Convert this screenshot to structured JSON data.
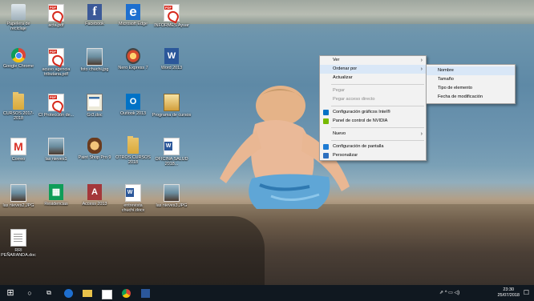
{
  "desktop_icons": [
    {
      "label": "Papelera de reciclaje",
      "icon": "recycle-bin-icon"
    },
    {
      "label": "acta.pdf",
      "icon": "pdf-icon"
    },
    {
      "label": "Facebook",
      "icon": "facebook-icon"
    },
    {
      "label": "Microsoft Edge",
      "icon": "edge-icon"
    },
    {
      "label": "INFORMES Ayuar",
      "icon": "pdf-icon"
    },
    {
      "label": "Google Chrome",
      "icon": "chrome-icon"
    },
    {
      "label": "acuso agencia tributaria.pdf",
      "icon": "pdf-icon"
    },
    {
      "label": "foto chuchi.jpg",
      "icon": "photo-icon"
    },
    {
      "label": "Nero Express 7",
      "icon": "nero-icon"
    },
    {
      "label": "Word 2013",
      "icon": "word-icon"
    },
    {
      "label": "CURSOS 2017-2018",
      "icon": "folder-icon"
    },
    {
      "label": "CI Protección de...",
      "icon": "access-doc-icon"
    },
    {
      "label": "Gr3.doc",
      "icon": "screenshot-icon"
    },
    {
      "label": "Outlook 2013",
      "icon": "outlook-icon"
    },
    {
      "label": "Programa de cursos",
      "icon": "installer-icon"
    },
    {
      "label": "Correo",
      "icon": "gmail-icon"
    },
    {
      "label": "las nieves1",
      "icon": "photo-icon"
    },
    {
      "label": "Paint Shop Pro 9",
      "icon": "paint-icon"
    },
    {
      "label": "OTROS CURSOS 2018",
      "icon": "folder-icon"
    },
    {
      "label": "OFICINA SALUD 2018...",
      "icon": "word-doc-icon"
    },
    {
      "label": "las nieves2.JPG",
      "icon": "photo-icon"
    },
    {
      "label": "Residencias",
      "icon": "sheets-icon"
    },
    {
      "label": "Access 2013",
      "icon": "access-icon"
    },
    {
      "label": "entrevista chuchi.docx",
      "icon": "word-doc-icon"
    },
    {
      "label": "las nieves3.JPG",
      "icon": "photo-icon"
    },
    {
      "label": "RRI PEÑARANDA.doc",
      "icon": "doc-icon"
    }
  ],
  "context_menu": {
    "items": [
      {
        "label": "Ver",
        "submenu": true,
        "disabled": false
      },
      {
        "label": "Ordenar por",
        "submenu": true,
        "disabled": false,
        "highlighted": true
      },
      {
        "label": "Actualizar",
        "submenu": false,
        "disabled": false
      },
      {
        "sep": true
      },
      {
        "label": "Pegar",
        "submenu": false,
        "disabled": true
      },
      {
        "label": "Pegar acceso directo",
        "submenu": false,
        "disabled": true
      },
      {
        "sep": true
      },
      {
        "label": "Configuración gráficos Intel®",
        "submenu": false,
        "disabled": false,
        "icon": "intel-icon"
      },
      {
        "label": "Panel de control de NVIDIA",
        "submenu": false,
        "disabled": false,
        "icon": "nvidia-icon"
      },
      {
        "sep": true
      },
      {
        "label": "Nuevo",
        "submenu": true,
        "disabled": false
      },
      {
        "sep": true
      },
      {
        "label": "Configuración de pantalla",
        "submenu": false,
        "disabled": false,
        "icon": "display-icon"
      },
      {
        "label": "Personalizar",
        "submenu": false,
        "disabled": false,
        "icon": "personalize-icon"
      }
    ]
  },
  "sort_submenu": {
    "items": [
      {
        "label": "Nombre",
        "highlighted": true
      },
      {
        "label": "Tamaño"
      },
      {
        "label": "Tipo de elemento"
      },
      {
        "label": "Fecha de modificación"
      }
    ]
  },
  "taskbar": {
    "start_glyph": "⊞",
    "search_glyph": "○",
    "taskview_glyph": "⧉",
    "clock_time": "23:30",
    "clock_date": "25/07/2018",
    "tray_glyphs": "⇗  ^  ▭  ◁)",
    "notification_glyph": "☐"
  },
  "colors": {
    "taskbar_bg": "#101820",
    "menu_bg": "#f2f2f2",
    "menu_highlight": "#d9e7f7"
  }
}
